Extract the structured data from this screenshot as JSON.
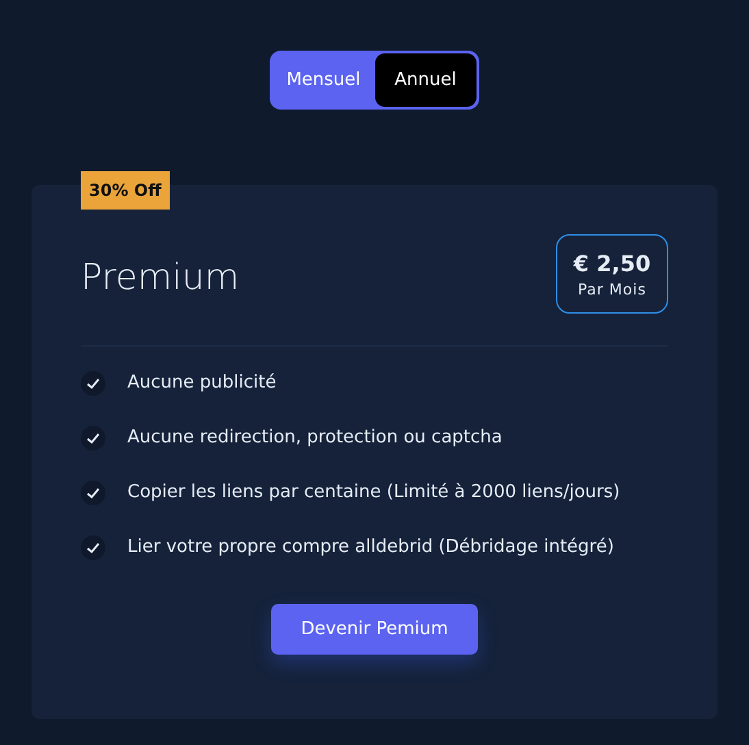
{
  "billing_toggle": [
    {
      "label": "Mensuel",
      "selected": false
    },
    {
      "label": "Annuel",
      "selected": true
    }
  ],
  "plan": {
    "badge": "30% Off",
    "name": "Premium",
    "price": "€ 2,50",
    "period": "Par Mois",
    "features": [
      {
        "text": "Aucune publicité",
        "included": true
      },
      {
        "text": "Aucune redirection, protection ou captcha",
        "included": true
      },
      {
        "text": "Copier les liens par centaine (Limité à 2000 liens/jours)",
        "included": true
      },
      {
        "text": "Lier votre propre compre alldebrid (Débridage intégré)",
        "included": true
      }
    ],
    "button": "Devenir Pemium"
  }
}
